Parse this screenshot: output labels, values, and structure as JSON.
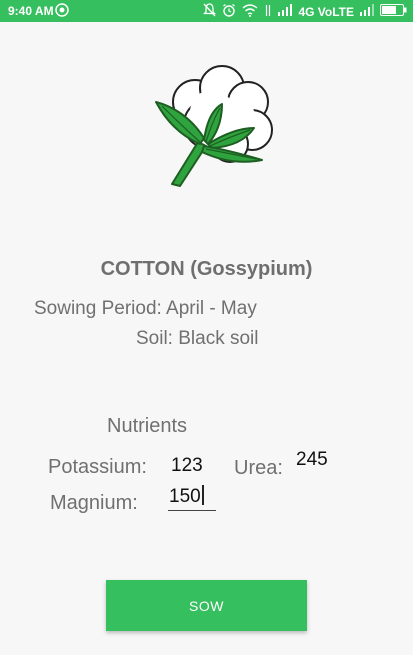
{
  "status_bar": {
    "time": "9:40 AM",
    "network": "4G VoLTE"
  },
  "crop": {
    "name": "COTTON (Gossypium)",
    "sowing_period": "Sowing Period: April - May",
    "soil": "Soil: Black soil"
  },
  "nutrients": {
    "heading": "Nutrients",
    "potassium_label": "Potassium:",
    "potassium_value": "123",
    "urea_label": "Urea:",
    "urea_value": "245",
    "magnesium_label": "Magnium:",
    "magnesium_value": "150"
  },
  "actions": {
    "sow_label": "SOW"
  },
  "colors": {
    "accent": "#35bf5e",
    "leaf": "#2e9e3e"
  },
  "icons": [
    "notification-off-icon",
    "alarm-icon",
    "wifi-icon",
    "signal-icon",
    "battery-icon",
    "cotton-plant-icon"
  ]
}
